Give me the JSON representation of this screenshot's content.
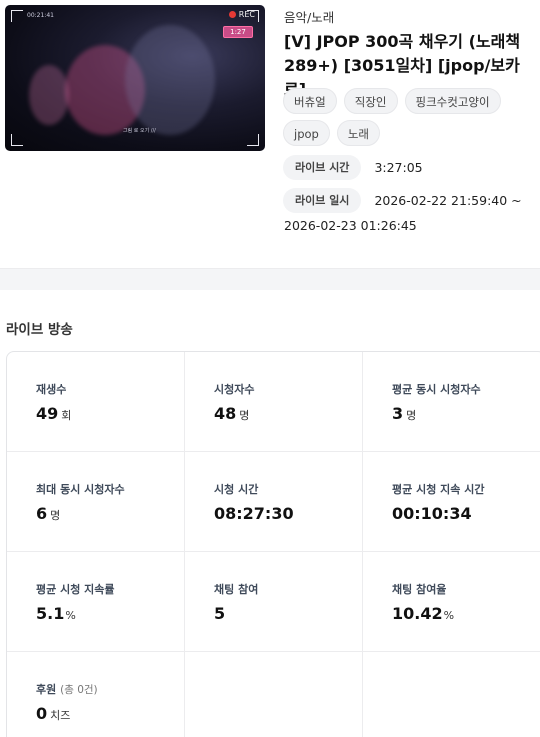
{
  "video": {
    "thumbnail": {
      "rec_label": "REC",
      "battery_text": "1:27",
      "time_text": "00:21:41",
      "bottom_text": "그림 로 오기 ///"
    },
    "category": "음악/노래",
    "title": "[V] JPOP 300곡 채우기 (노래책 289+) [3051일차] [jpop/보카로]",
    "tags": [
      "버츄얼",
      "직장인",
      "핑크수컷고양이",
      "jpop",
      "노래"
    ],
    "live_time_label": "라이브 시간",
    "live_time_value": "3:27:05",
    "live_date_label": "라이브 일시",
    "live_date_value_1": "2026-02-22 21:59:40 ~",
    "live_date_value_2": "2026-02-23 01:26:45"
  },
  "stats": {
    "section_title": "라이브 방송",
    "items": [
      {
        "label": "재생수",
        "value": "49",
        "unit": "회"
      },
      {
        "label": "시청자수",
        "value": "48",
        "unit": "명"
      },
      {
        "label": "평균 동시 시청자수",
        "value": "3",
        "unit": "명"
      },
      {
        "label": "최대 동시 시청자수",
        "value": "6",
        "unit": "명"
      },
      {
        "label": "시청 시간",
        "value": "08:27:30",
        "unit": ""
      },
      {
        "label": "평균 시청 지속 시간",
        "value": "00:10:34",
        "unit": ""
      },
      {
        "label": "평균 시청 지속률",
        "value": "5.1",
        "unit": "%"
      },
      {
        "label": "채팅 참여",
        "value": "5",
        "unit": ""
      },
      {
        "label": "채팅 참여율",
        "value": "10.42",
        "unit": "%"
      },
      {
        "label": "후원",
        "label_sub": "(총 0건)",
        "value": "0",
        "unit": "치즈"
      }
    ]
  },
  "colors": {
    "tag_bg": "#f2f3f5",
    "label_color": "#3f4a5a",
    "band_bg": "#f4f5f7",
    "rec_dot": "#e53935",
    "battery_pink": "#ff6fa5"
  }
}
